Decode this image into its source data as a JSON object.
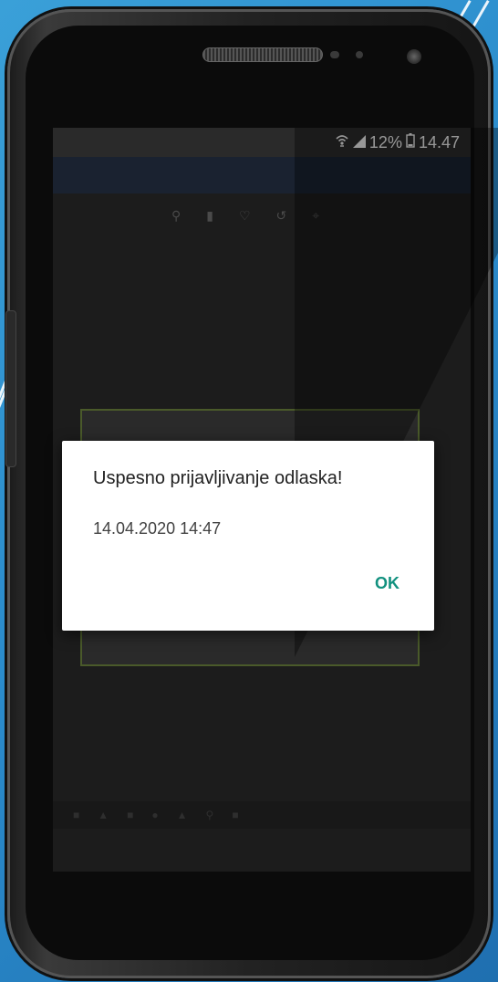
{
  "status_bar": {
    "wifi_icon": "wifi-icon",
    "signal_icon": "signal-icon",
    "battery_percent": "12%",
    "battery_icon": "battery-icon",
    "time": "14.47"
  },
  "toolbar": {
    "icons": [
      "zoom-icon",
      "delete-icon",
      "heart-icon",
      "undo-icon",
      "crop-icon"
    ]
  },
  "dialog": {
    "title": "Uspesno prijavljivanje odlaska!",
    "message": "14.04.2020 14:47",
    "ok_label": "OK"
  },
  "colors": {
    "accent": "#12917f",
    "background_blue": "#2b8ccc"
  }
}
